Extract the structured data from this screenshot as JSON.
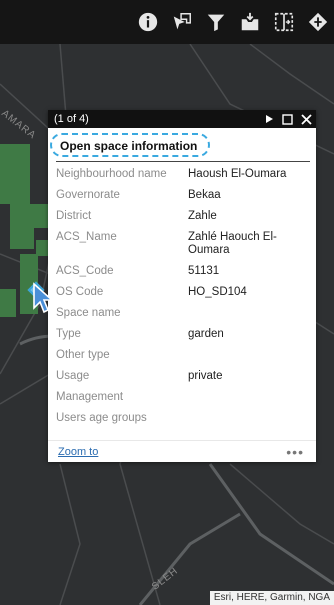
{
  "toolbar": {
    "icons": [
      "info-icon",
      "select-features-icon",
      "filter-icon",
      "inbox-icon",
      "split-view-icon",
      "share-icon"
    ]
  },
  "map": {
    "labels": [
      "AMARA",
      "SLEH"
    ],
    "attribution": "Esri, HERE, Garmin, NGA"
  },
  "popup": {
    "pager": "(1 of 4)",
    "title": "Open space information",
    "fields": [
      {
        "name": "Neighbourhood name",
        "value": "Haoush El-Oumara"
      },
      {
        "name": "Governorate",
        "value": "Bekaa"
      },
      {
        "name": "District",
        "value": "Zahle"
      },
      {
        "name": "ACS_Name",
        "value": "Zahlé Haouch El-Oumara"
      },
      {
        "name": "ACS_Code",
        "value": "51131"
      },
      {
        "name": "OS Code",
        "value": "HO_SD104"
      },
      {
        "name": "Space name",
        "value": ""
      },
      {
        "name": "Type",
        "value": "garden"
      },
      {
        "name": "Other type",
        "value": ""
      },
      {
        "name": "Usage",
        "value": "private"
      },
      {
        "name": "Management",
        "value": ""
      },
      {
        "name": "Users age groups",
        "value": ""
      }
    ],
    "zoom_label": "Zoom to",
    "more_label": "•••"
  },
  "colors": {
    "toolbar_bg": "#151515",
    "map_bg": "#2e3032",
    "park_green": "#3f7a45",
    "highlight": "#3aa9e0",
    "link": "#2b6cb0"
  }
}
